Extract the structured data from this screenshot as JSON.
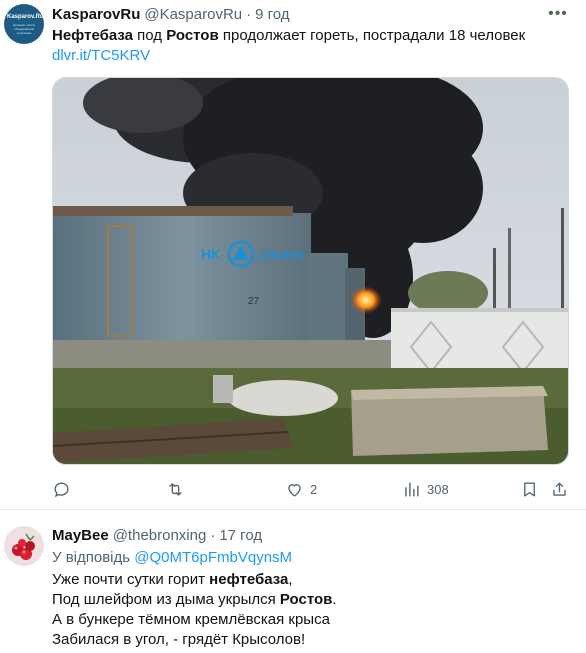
{
  "tweet": {
    "author_name": "KasparovRu",
    "handle": "@KasparovRu",
    "separator": "·",
    "time": "9 год",
    "avatar_title": "Kasparov.Ru",
    "avatar_subtitle": "интернет-газета объединённой оппозиции",
    "text_b1": "Нефтебаза",
    "text_1": " под ",
    "text_b2": "Ростов",
    "text_2": " продолжает гореть, пострадали 18 человек",
    "link": "dlvr.it/TC5KRV",
    "photo": {
      "tank_logo_left": "НК",
      "tank_logo_right": "АЛЬЯНС",
      "tank_number": "27"
    },
    "actions": {
      "reply_icon": "reply-icon",
      "retweet_icon": "retweet-icon",
      "like_icon": "heart-icon",
      "like_count": "2",
      "views_icon": "views-icon",
      "views_count": "308",
      "bookmark_icon": "bookmark-icon",
      "share_icon": "share-icon"
    }
  },
  "reply": {
    "author_name": "MayBee",
    "handle": "@thebronxing",
    "separator": "·",
    "time": "17 год",
    "reply_prefix": "У відповідь",
    "reply_mention": "@Q0MT6pFmbVqynsM",
    "line1_a": "Уже почти сутки горит ",
    "line1_b": "нефтебаза",
    "line1_c": ",",
    "line2_a": "Под шлейфом из дыма укрылся ",
    "line2_b": "Ростов",
    "line2_c": ".",
    "line3": "А в бункере тёмном кремлёвская крыса",
    "line4": "Забилася в угол, - грядёт Крысолов!"
  },
  "colors": {
    "text": "#0f1419",
    "secondary": "#536471",
    "link": "#1d9bf0",
    "divider": "#e6ecf0"
  }
}
